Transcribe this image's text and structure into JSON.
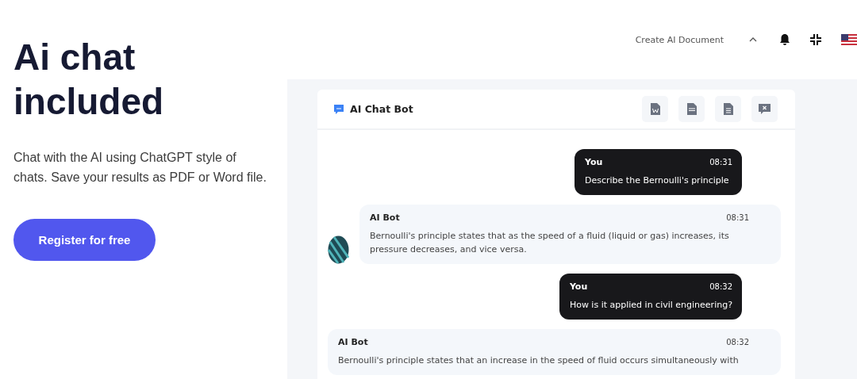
{
  "hero": {
    "title": "Ai chat included",
    "description": "Chat with the AI using ChatGPT style of chats. Save your results as PDF or Word file.",
    "cta": "Register for free"
  },
  "topbar": {
    "menu_label": "Create AI Document"
  },
  "chat": {
    "title": "AI Chat Bot",
    "messages": [
      {
        "kind": "user",
        "author": "You",
        "time": "08:31",
        "text": "Describe the Bernoulli's principle",
        "avatar": false
      },
      {
        "kind": "bot",
        "author": "AI Bot",
        "time": "08:31",
        "text": "Bernoulli's principle states that as the speed of a fluid (liquid or gas) increases, its pressure decreases, and vice versa.",
        "avatar": true
      },
      {
        "kind": "user",
        "author": "You",
        "time": "08:32",
        "text": "How is it applied in civil engineering?",
        "avatar": false
      },
      {
        "kind": "bot",
        "author": "AI Bot",
        "time": "08:32",
        "text": "Bernoulli's principle states that an increase in the speed of fluid occurs simultaneously with",
        "avatar": false
      }
    ]
  }
}
